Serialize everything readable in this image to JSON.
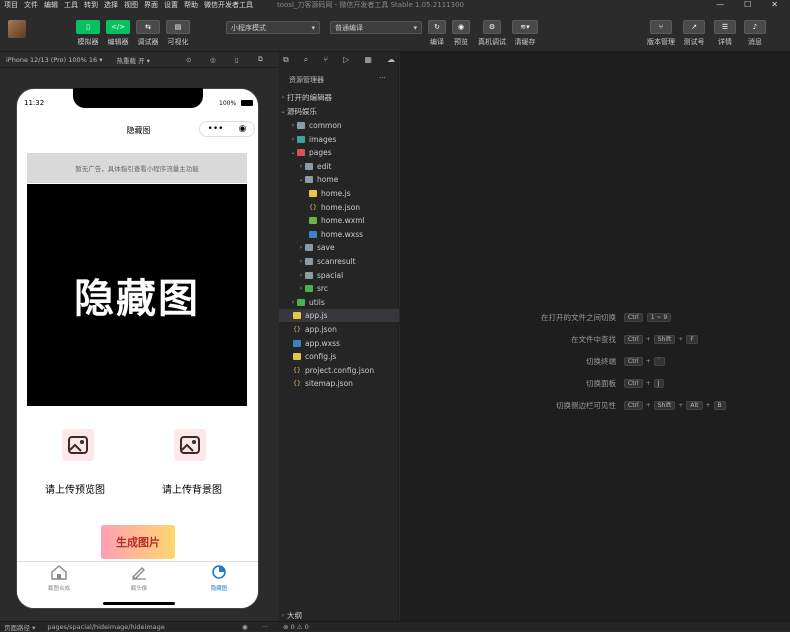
{
  "menubar": {
    "items": [
      "项目",
      "文件",
      "编辑",
      "工具",
      "转到",
      "选择",
      "视图",
      "界面",
      "设置",
      "帮助",
      "微信开发者工具"
    ],
    "title": "toosl_刀客源码网 - 微信开发者工具 Stable 1.05.2111300"
  },
  "toolbar": {
    "simulator": "模拟器",
    "editor": "编辑器",
    "debugger": "调试器",
    "visual": "可视化",
    "mode_select": "小程序模式",
    "compile_select": "普通编译",
    "compile": "编译",
    "preview": "预览",
    "real_debug": "真机调试",
    "clear_cache": "清缓存",
    "version": "版本管理",
    "test": "测试号",
    "details": "详情",
    "messages": "消息"
  },
  "sim": {
    "device": "iPhone 12/13 (Pro) 100% 16 ▾",
    "hotreload": "热重载 开 ▾"
  },
  "phone": {
    "time": "11:32",
    "battery": "100%",
    "nav_title": "隐藏图",
    "notice": "暂无广告，具体指引查看小程序流量主功能",
    "banner_text": "隐藏图",
    "upload_preview": "请上传预览图",
    "upload_bg": "请上传背景图",
    "generate": "生成图片",
    "tabs": [
      {
        "label": "截图合成"
      },
      {
        "label": "截头像"
      },
      {
        "label": "隐藏图"
      }
    ],
    "accent": "#07c160",
    "tab_active_color": "#1a7bd6"
  },
  "explorer": {
    "title": "资源管理器",
    "more": "···",
    "open_editors": "打开的编辑器",
    "project": "源码娱乐",
    "outline": "大纲",
    "items": [
      {
        "label": "common",
        "type": "folder",
        "depth": 1,
        "open": false
      },
      {
        "label": "images",
        "type": "folder-img",
        "depth": 1,
        "open": false
      },
      {
        "label": "pages",
        "type": "folder-red",
        "depth": 1,
        "open": true
      },
      {
        "label": "edit",
        "type": "folder",
        "depth": 2,
        "open": false
      },
      {
        "label": "home",
        "type": "folder",
        "depth": 2,
        "open": true
      },
      {
        "label": "home.js",
        "type": "js",
        "depth": 3
      },
      {
        "label": "home.json",
        "type": "json",
        "depth": 3
      },
      {
        "label": "home.wxml",
        "type": "wxml",
        "depth": 3
      },
      {
        "label": "home.wxss",
        "type": "wxss",
        "depth": 3
      },
      {
        "label": "save",
        "type": "folder",
        "depth": 2,
        "open": false
      },
      {
        "label": "scanresult",
        "type": "folder",
        "depth": 2,
        "open": false
      },
      {
        "label": "spacial",
        "type": "folder",
        "depth": 2,
        "open": false
      },
      {
        "label": "src",
        "type": "folder-green",
        "depth": 2,
        "open": false
      },
      {
        "label": "utils",
        "type": "folder-green",
        "depth": 1,
        "open": false
      },
      {
        "label": "app.js",
        "type": "js",
        "depth": 1,
        "active": true
      },
      {
        "label": "app.json",
        "type": "json",
        "depth": 1
      },
      {
        "label": "app.wxss",
        "type": "wxss",
        "depth": 1
      },
      {
        "label": "config.js",
        "type": "js",
        "depth": 1
      },
      {
        "label": "project.config.json",
        "type": "json",
        "depth": 1
      },
      {
        "label": "sitemap.json",
        "type": "json",
        "depth": 1
      }
    ]
  },
  "editor": {
    "hints": [
      {
        "label": "在打开的文件之间切换",
        "keys": [
          "Ctrl",
          "1 ~ 9"
        ]
      },
      {
        "label": "在文件中查找",
        "keys": [
          "Ctrl",
          "+",
          "Shift",
          "+",
          "F"
        ]
      },
      {
        "label": "切换终端",
        "keys": [
          "Ctrl",
          "+",
          "`"
        ]
      },
      {
        "label": "切换面板",
        "keys": [
          "Ctrl",
          "+",
          "J"
        ]
      },
      {
        "label": "切换侧边栏可见性",
        "keys": [
          "Ctrl",
          "+",
          "Shift",
          "+",
          "Alt",
          "+",
          "B"
        ]
      }
    ]
  },
  "status": {
    "path_label": "页面路径 ▾",
    "path": "pages/spacial/hideimage/hideimage",
    "errors": "⊗ 0 ⚠ 0"
  }
}
